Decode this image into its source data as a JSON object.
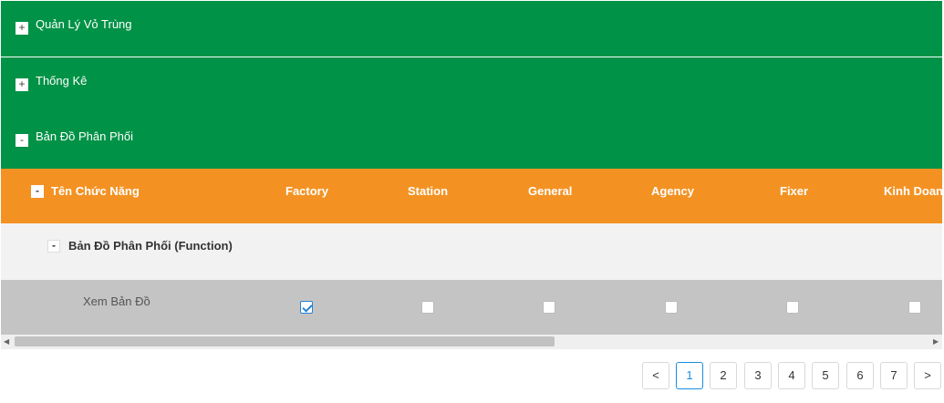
{
  "sections": [
    {
      "toggle": "+",
      "title": "Quản Lý Vỏ Trùng"
    },
    {
      "toggle": "+",
      "title": "Thống Kê"
    },
    {
      "toggle": "-",
      "title": "Bản Đồ Phân Phối"
    }
  ],
  "table": {
    "header": {
      "toggle": "-",
      "name_col": "Tên Chức Năng",
      "columns": [
        "Factory",
        "Station",
        "General",
        "Agency",
        "Fixer",
        "Kinh Doanh"
      ]
    },
    "group": {
      "toggle": "-",
      "label": "Bản Đồ Phân Phối (Function)"
    },
    "rows": [
      {
        "label": "Xem Bản Đồ",
        "checked": [
          true,
          false,
          false,
          false,
          false,
          false
        ]
      }
    ]
  },
  "scrollbar": {
    "left_arrow": "◀",
    "right_arrow": "▶"
  },
  "pagination": {
    "prev": "<",
    "next": ">",
    "pages": [
      "1",
      "2",
      "3",
      "4",
      "5",
      "6",
      "7"
    ],
    "current": "1"
  },
  "colors": {
    "section_bg": "#009246",
    "header_bg": "#f39223",
    "accent": "#2684d6"
  }
}
